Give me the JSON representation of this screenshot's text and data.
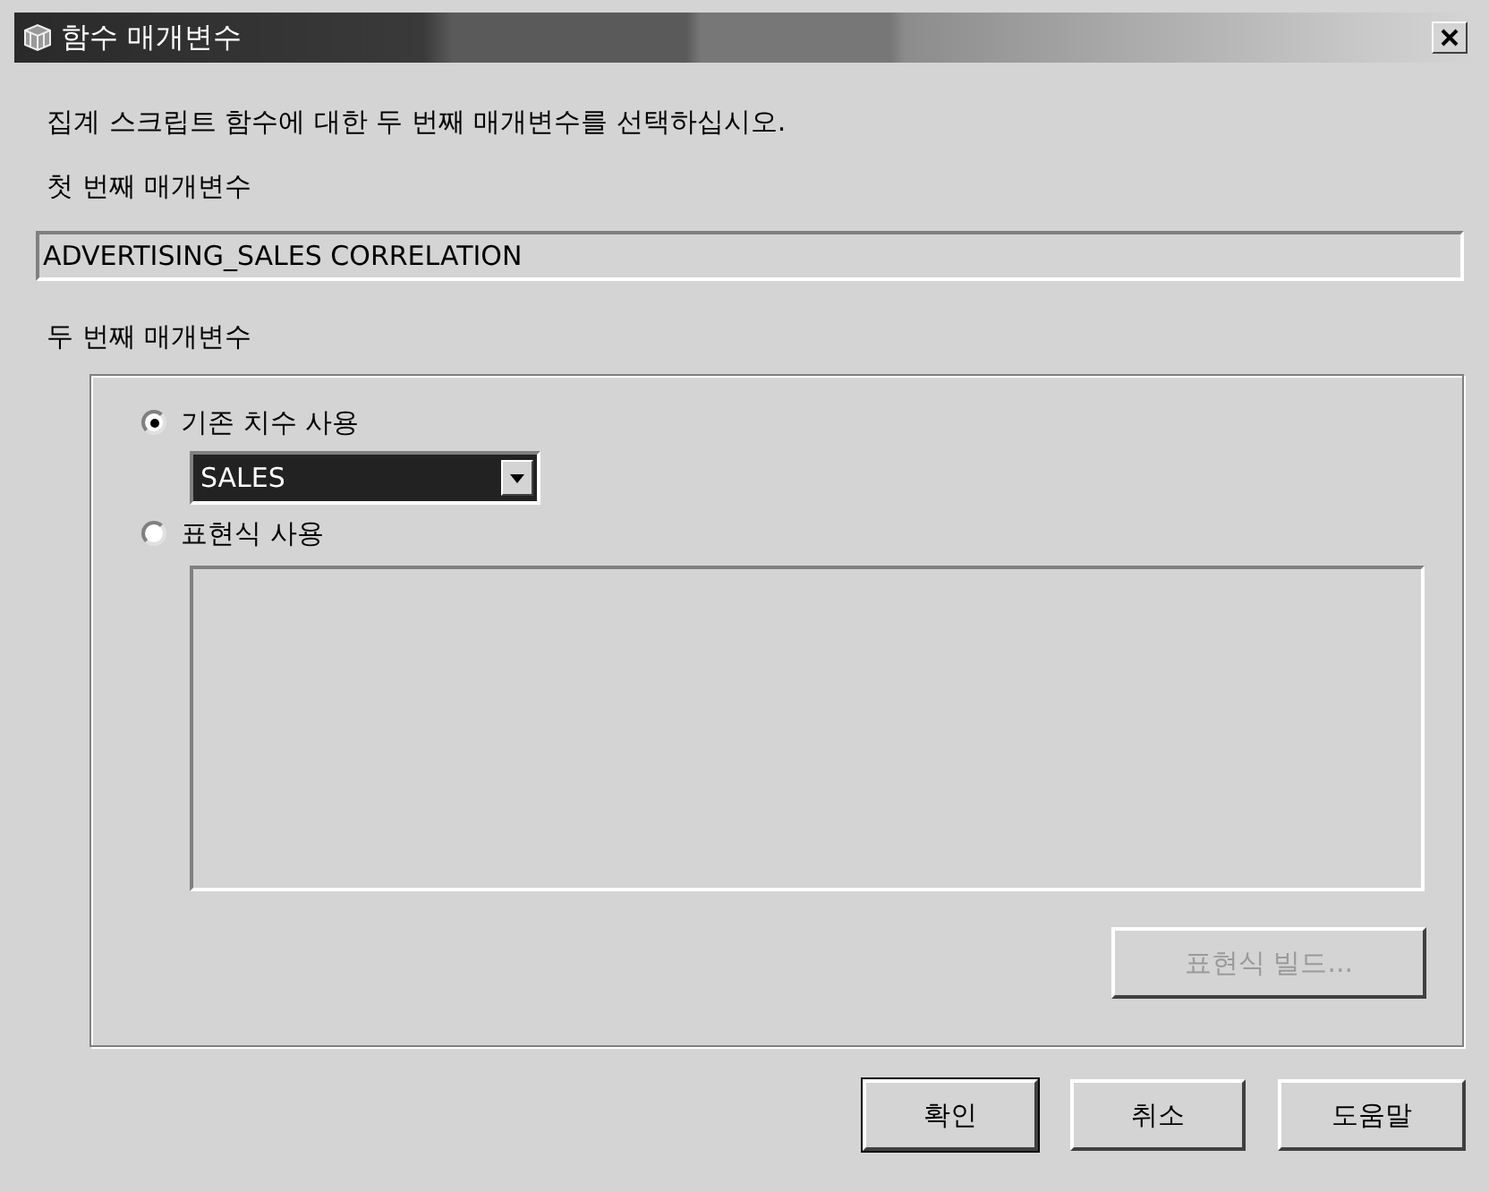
{
  "window": {
    "title": "함수 매개변수"
  },
  "instruction": "집계 스크립트 함수에 대한 두 번째 매개변수를 선택하십시오.",
  "first_parameter": {
    "label": "첫 번째 매개변수",
    "value": "ADVERTISING_SALES CORRELATION"
  },
  "second_parameter": {
    "label": "두 번째 매개변수",
    "options": [
      {
        "kind": "dimension",
        "label": "기존 치수 사용",
        "selected": true
      },
      {
        "kind": "expression",
        "label": "표현식 사용",
        "selected": false
      }
    ],
    "dimension_dropdown": {
      "value": "SALES"
    },
    "build_button": {
      "label": "표현식 빌드...",
      "disabled": true
    }
  },
  "buttons": [
    {
      "label": "확인",
      "default": true
    },
    {
      "label": "취소",
      "default": false
    },
    {
      "label": "도움말",
      "default": false
    }
  ]
}
